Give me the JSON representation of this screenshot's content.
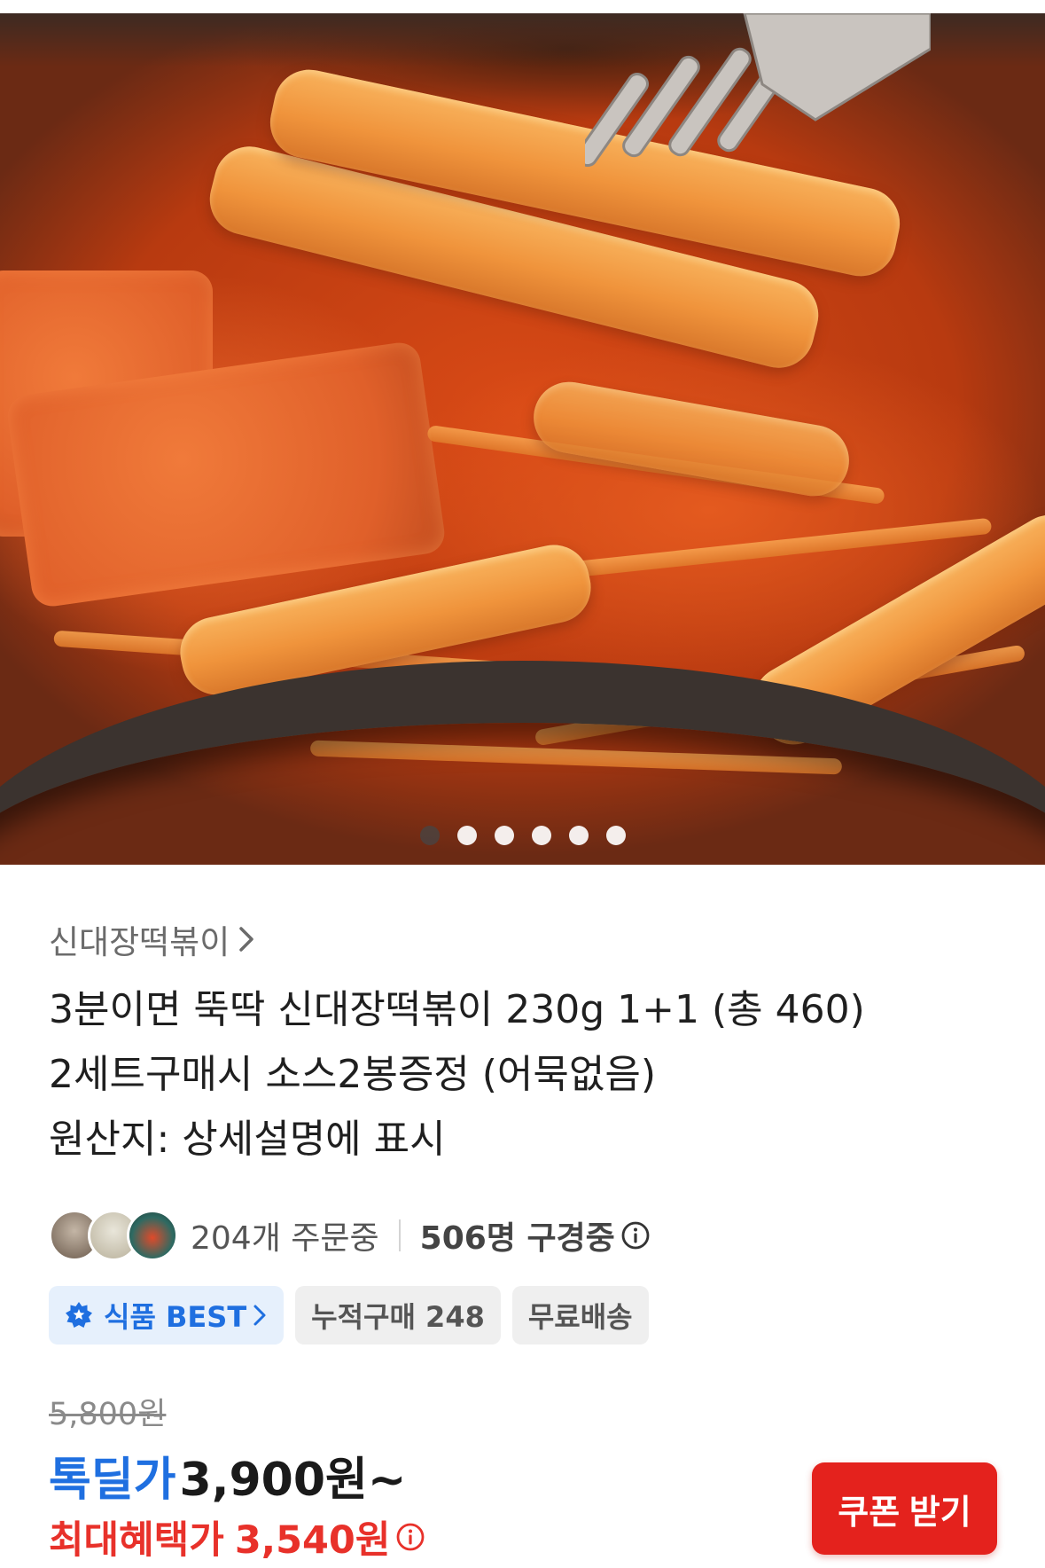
{
  "product_image": {
    "alt": "",
    "carousel_count": 6,
    "carousel_active_index": 0
  },
  "breadcrumb": {
    "label": "신대장떡볶이"
  },
  "title": {
    "line1": "3분이면 뚝딱 신대장떡볶이 230g 1+1 (총 460)",
    "line2": "2세트구매시 소스2봉증정 (어묵없음)",
    "line3": "원산지: 상세설명에 표시"
  },
  "social_proof": {
    "orders": "204개 주문중",
    "viewers": "506명 구경중"
  },
  "chips": {
    "best": "식품 BEST",
    "cumulative": "누적구매 248",
    "shipping": "무료배송"
  },
  "price": {
    "original": "5,800원",
    "deal_label": "톡딜가",
    "deal_price": "3,900원~",
    "max_label": "최대혜택가",
    "max_price": "3,540원"
  },
  "coupon_button": {
    "label": "쿠폰 받기"
  },
  "colors": {
    "accent_blue": "#1f6fe0",
    "accent_red": "#e8312a",
    "coupon_bg": "#e4221d"
  }
}
